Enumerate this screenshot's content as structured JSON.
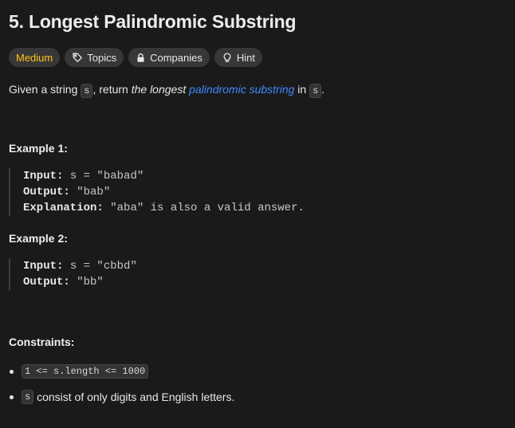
{
  "problem": {
    "title": "5. Longest Palindromic Substring",
    "tags": {
      "difficulty": "Medium",
      "topics": "Topics",
      "companies": "Companies",
      "hint": "Hint"
    },
    "description": {
      "part1": "Given a string ",
      "code1": "s",
      "part2": ", return ",
      "emph": "the longest",
      "link": "palindromic substring",
      "part3": " in ",
      "code2": "s",
      "part4": "."
    },
    "examples": [
      {
        "heading": "Example 1:",
        "input_label": "Input:",
        "input_value": "s = \"babad\"",
        "output_label": "Output:",
        "output_value": "\"bab\"",
        "explanation_label": "Explanation:",
        "explanation_value": "\"aba\" is also a valid answer."
      },
      {
        "heading": "Example 2:",
        "input_label": "Input:",
        "input_value": "s = \"cbbd\"",
        "output_label": "Output:",
        "output_value": "\"bb\""
      }
    ],
    "constraints": {
      "heading": "Constraints:",
      "items": [
        {
          "code": "1 <= s.length <= 1000",
          "text": ""
        },
        {
          "code": "s",
          "text": "consist of only digits and English letters."
        }
      ]
    }
  },
  "colors": {
    "background": "#1a1a1a",
    "difficulty_medium": "#ffc01e",
    "link": "#3e8bff",
    "tag_background": "#373737"
  },
  "icons": {
    "topics": "tag-icon",
    "companies": "lock-icon",
    "hint": "lightbulb-icon"
  }
}
